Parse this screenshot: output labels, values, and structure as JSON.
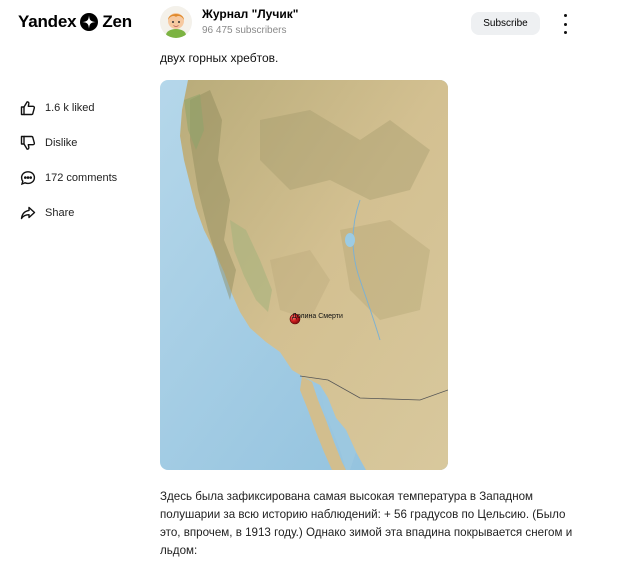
{
  "header": {
    "logo_text_left": "Yandex",
    "logo_text_right": "Zen",
    "channel_name": "Журнал \"Лучик\"",
    "channel_subscribers": "96 475 subscribers",
    "subscribe_label": "Subscribe"
  },
  "sidebar": {
    "items": [
      {
        "icon": "thumbs-up-icon",
        "label": "1.6 k liked"
      },
      {
        "icon": "thumbs-down-icon",
        "label": "Dislike"
      },
      {
        "icon": "comment-icon",
        "label": "172 comments"
      },
      {
        "icon": "share-icon",
        "label": "Share"
      }
    ]
  },
  "article": {
    "lead_text": "двух горных хребтов.",
    "map_label": "Долина Смерти",
    "paragraph": "Здесь была зафиксирована самая высокая температура в Западном полушарии за всю историю наблюдений: + 56 градусов по Цельсию. (Было это, впрочем, в 1913 году.) Однако зимой эта впадина покрывается снегом и льдом:"
  },
  "colors": {
    "subscribe_bg": "#eef0f2",
    "map_water": "#a9cfe6",
    "map_land": "#cdb98d",
    "marker": "#c0181c"
  }
}
